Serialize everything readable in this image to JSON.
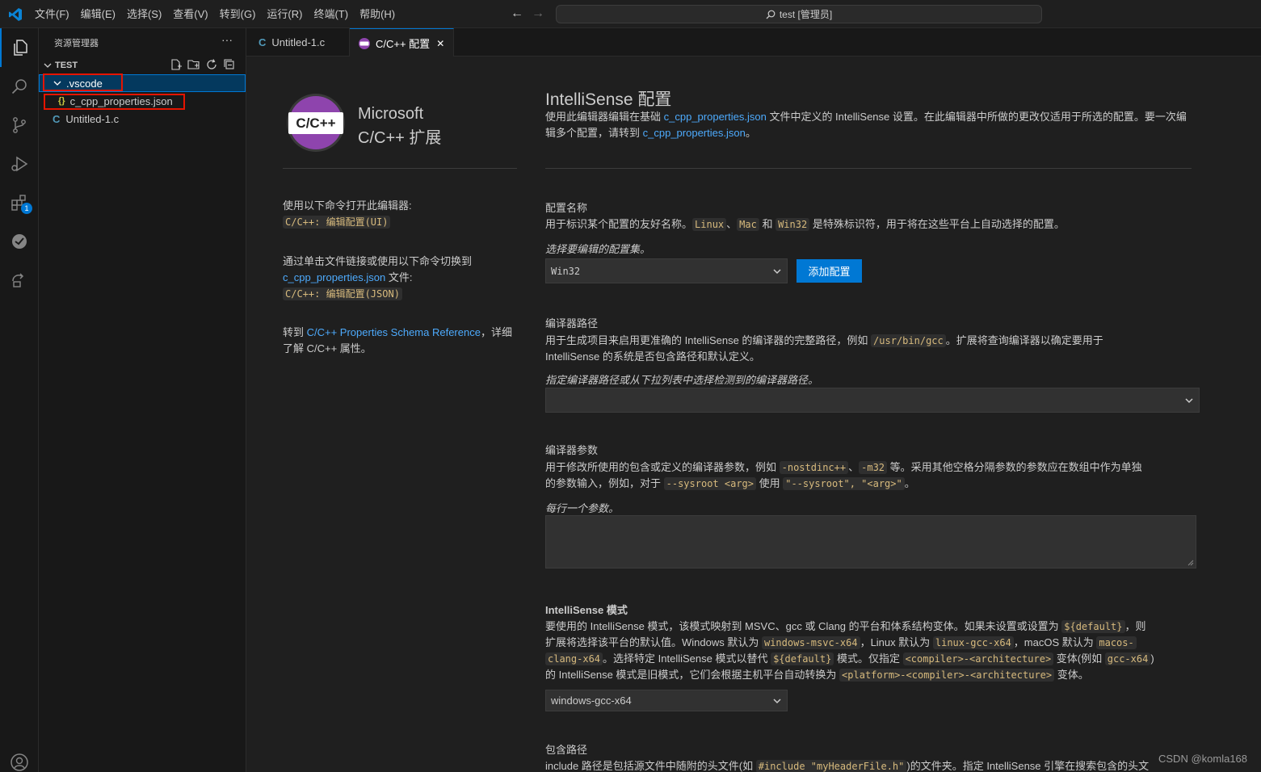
{
  "menu": [
    "文件(F)",
    "编辑(E)",
    "选择(S)",
    "查看(V)",
    "转到(G)",
    "运行(R)",
    "终端(T)",
    "帮助(H)"
  ],
  "command_center": "test [管理员]",
  "colors": {
    "accent": "#0078d4",
    "highlight_box": "#e51400",
    "link": "#4daafc",
    "code": "#d7ba7d",
    "cpp_logo": "#8e44ad"
  },
  "sidebar": {
    "title": "资源管理器",
    "more": "···",
    "section": "TEST",
    "items": [
      {
        "label": ".vscode",
        "icon": "chevron-down-icon"
      },
      {
        "label": "c_cpp_properties.json",
        "icon_text": "{}"
      },
      {
        "label": "Untitled-1.c",
        "icon_text": "C"
      }
    ]
  },
  "tabs": [
    {
      "label": "Untitled-1.c",
      "icon_text": "C"
    },
    {
      "label": "C/C++ 配置",
      "close": "✕"
    }
  ],
  "left_panel": {
    "brand_line1": "Microsoft",
    "brand_line2": "C/C++ 扩展",
    "logo_text": "C/C++",
    "cmd1_text": "使用以下命令打开此编辑器:",
    "cmd1_code": "C/C++: 编辑配置(UI)",
    "cmd2_text": "通过单击文件链接或使用以下命令切换到",
    "cmd2_link": "c_cpp_properties.json",
    "cmd2_suffix": " 文件:",
    "cmd2_code": "C/C++: 编辑配置(JSON)",
    "ref_prefix": "转到 ",
    "ref_link": "C/C++ Properties Schema Reference",
    "ref_suffix": "，详细",
    "ref_line2": "了解 C/C++ 属性。"
  },
  "main": {
    "title": "IntelliSense 配置",
    "desc_a": "使用此编辑器编辑在基础 ",
    "desc_link1": "c_cpp_properties.json",
    "desc_b": " 文件中定义的 IntelliSense 设置。在此编辑器中所做的更改仅适用于所选的配置。要一次编",
    "desc_c": "辑多个配置，请转到 ",
    "desc_link2": "c_cpp_properties.json",
    "desc_d": "。",
    "config_name": {
      "heading": "配置名称",
      "desc_a": "用于标识某个配置的友好名称。",
      "code_linux": "Linux",
      "sep1": "、",
      "code_mac": "Mac",
      "sep2": " 和 ",
      "code_win32": "Win32",
      "desc_b": " 是特殊标识符，用于将在这些平台上自动选择的配置。",
      "hint": "选择要编辑的配置集。",
      "selected": "Win32",
      "add_button": "添加配置"
    },
    "compiler_path": {
      "heading": "编译器路径",
      "desc_a": "用于生成项目来启用更准确的 IntelliSense 的编译器的完整路径，例如 ",
      "code": "/usr/bin/gcc",
      "desc_b": "。扩展将查询编译器以确定要用于",
      "desc_c": "IntelliSense 的系统是否包含路径和默认定义。",
      "hint": "指定编译器路径或从下拉列表中选择检测到的编译器路径。",
      "value": ""
    },
    "compiler_args": {
      "heading": "编译器参数",
      "desc_a": "用于修改所使用的包含或定义的编译器参数，例如 ",
      "code1": "-nostdinc++",
      "sep1": "、",
      "code2": "-m32",
      "desc_b": " 等。采用其他空格分隔参数的参数应在数组中作为单独",
      "desc_c": "的参数输入，例如，对于 ",
      "code3": "--sysroot <arg>",
      "desc_d": " 使用 ",
      "code4": "\"--sysroot\", \"<arg>\"",
      "desc_e": "。",
      "hint": "每行一个参数。"
    },
    "intellisense_mode": {
      "heading": "IntelliSense 模式",
      "l1a": "要使用的 IntelliSense 模式，该模式映射到 MSVC、gcc 或 Clang 的平台和体系结构变体。如果未设置或设置为 ",
      "l1code": "${default}",
      "l1b": "，则",
      "l2a": "扩展将选择该平台的默认值。Windows 默认为 ",
      "l2code1": "windows-msvc-x64",
      "l2b": "，Linux 默认为 ",
      "l2code2": "linux-gcc-x64",
      "l2c": "，macOS 默认为 ",
      "l2code3": "macos-",
      "l3code0": "clang-x64",
      "l3a": "。选择特定 IntelliSense 模式以替代 ",
      "l3code1": "${default}",
      "l3b": " 模式。仅指定 ",
      "l3code2": "<compiler>-<architecture>",
      "l3c": " 变体(例如 ",
      "l3code3": "gcc-x64",
      "l3d": ")",
      "l4a": "的 IntelliSense 模式是旧模式，它们会根据主机平台自动转换为 ",
      "l4code": "<platform>-<compiler>-<architecture>",
      "l4b": " 变体。",
      "selected": "windows-gcc-x64"
    },
    "include_path": {
      "heading": "包含路径",
      "desc_a": "include 路径是包括源文件中随附的头文件(如 ",
      "code": "#include \"myHeaderFile.h\"",
      "desc_b": ")的文件夹。指定 IntelliSense 引擎在搜索包含的头文"
    }
  },
  "watermark": "CSDN @komla168"
}
